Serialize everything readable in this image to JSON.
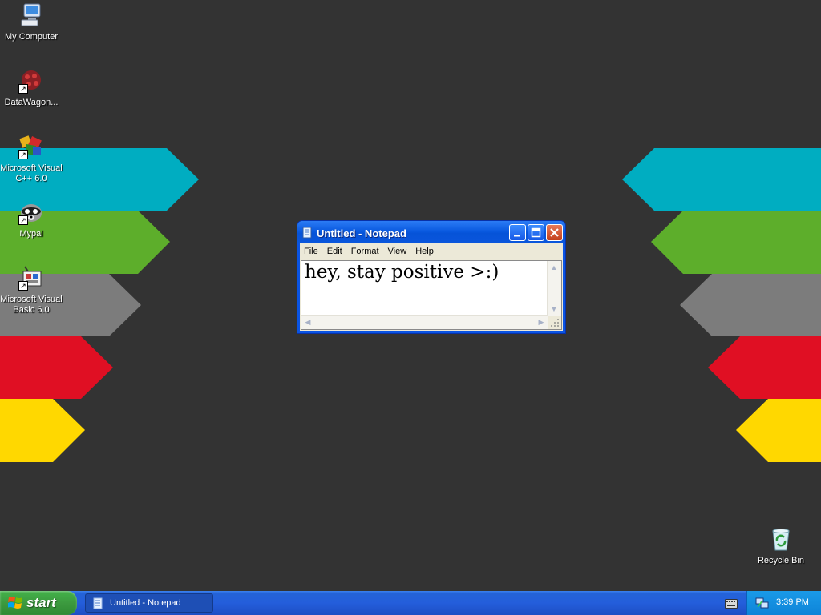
{
  "desktop": {
    "icons": [
      {
        "label": "My Computer",
        "icon": "my-computer-icon"
      },
      {
        "label": "DataWagon...",
        "icon": "datawagon-icon"
      },
      {
        "label": "Microsoft Visual C++ 6.0",
        "icon": "visual-cpp-icon"
      },
      {
        "label": "Mypal",
        "icon": "mypal-icon"
      },
      {
        "label": "Microsoft Visual Basic 6.0",
        "icon": "visual-basic-icon"
      },
      {
        "label": "Recycle Bin",
        "icon": "recycle-bin-icon"
      }
    ],
    "wallpaper_colors": [
      "#00adc1",
      "#5dae2b",
      "#7c7c7c",
      "#e00f23",
      "#ffd800"
    ],
    "background": "#333333"
  },
  "notepad": {
    "title": "Untitled - Notepad",
    "menu": [
      "File",
      "Edit",
      "Format",
      "View",
      "Help"
    ],
    "content": "hey, stay positive >:)"
  },
  "taskbar": {
    "start_label": "start",
    "task_label": "Untitled - Notepad",
    "clock": "3:39 PM"
  }
}
